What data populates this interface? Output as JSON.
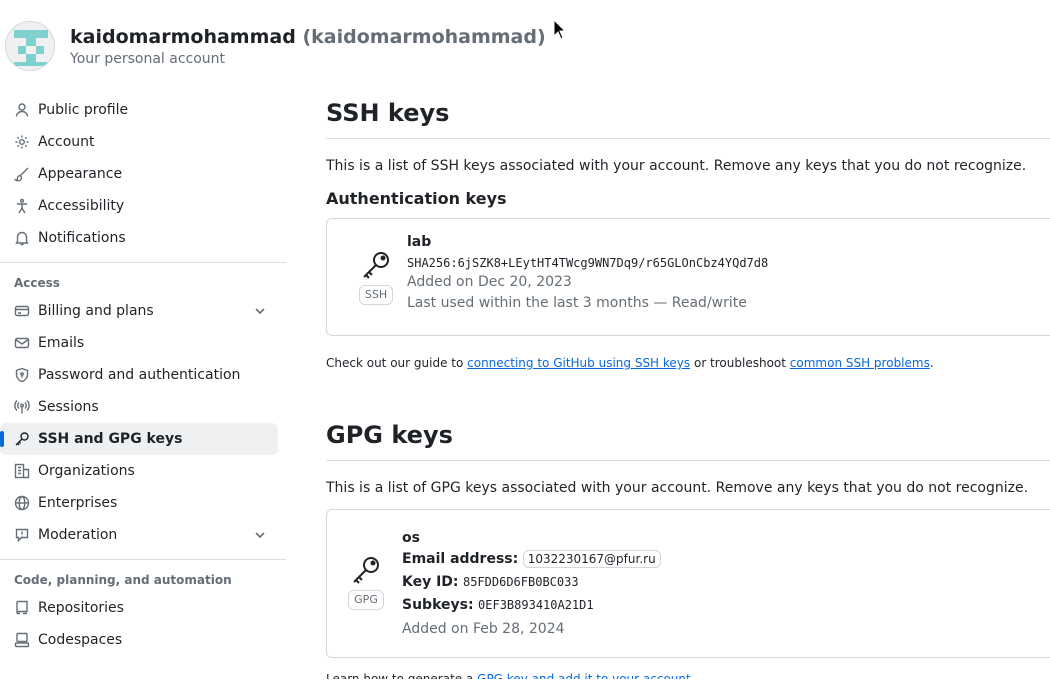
{
  "user": {
    "name": "kaidomarmohammad",
    "login": "(kaidomarmohammad)",
    "subtitle": "Your personal account"
  },
  "sidebar": {
    "items": [
      {
        "label": "Public profile",
        "icon": "person-icon"
      },
      {
        "label": "Account",
        "icon": "gear-icon"
      },
      {
        "label": "Appearance",
        "icon": "paintbrush-icon"
      },
      {
        "label": "Accessibility",
        "icon": "accessibility-icon"
      },
      {
        "label": "Notifications",
        "icon": "bell-icon"
      }
    ],
    "access_title": "Access",
    "access_items": [
      {
        "label": "Billing and plans",
        "icon": "credit-card-icon"
      },
      {
        "label": "Emails",
        "icon": "mail-icon"
      },
      {
        "label": "Password and authentication",
        "icon": "shield-lock-icon"
      },
      {
        "label": "Sessions",
        "icon": "broadcast-icon"
      },
      {
        "label": "SSH and GPG keys",
        "icon": "key-icon"
      },
      {
        "label": "Organizations",
        "icon": "organization-icon"
      },
      {
        "label": "Enterprises",
        "icon": "globe-icon"
      },
      {
        "label": "Moderation",
        "icon": "report-icon"
      }
    ],
    "code_title": "Code, planning, and automation",
    "code_items": [
      {
        "label": "Repositories",
        "icon": "repo-icon"
      },
      {
        "label": "Codespaces",
        "icon": "codespaces-icon"
      }
    ]
  },
  "ssh": {
    "title": "SSH keys",
    "description": "This is a list of SSH keys associated with your account. Remove any keys that you do not recognize.",
    "auth_title": "Authentication keys",
    "key": {
      "type_label": "SSH",
      "title": "lab",
      "fingerprint": "SHA256:6jSZK8+LEytHT4TWcg9WN7Dq9/r65GLOnCbz4YQd7d8",
      "added": "Added on Dec 20, 2023",
      "last_used": "Last used within the last 3 months — Read/write"
    },
    "help_prefix": "Check out our guide to ",
    "help_link1": "connecting to GitHub using SSH keys",
    "help_middle": " or troubleshoot ",
    "help_link2": "common SSH problems",
    "help_suffix": "."
  },
  "gpg": {
    "title": "GPG keys",
    "description": "This is a list of GPG keys associated with your account. Remove any keys that you do not recognize.",
    "key": {
      "type_label": "GPG",
      "title": "os",
      "email_label": "Email address:",
      "email": "1032230167@pfur.ru",
      "keyid_label": "Key ID:",
      "keyid": "85FDD6D6FB0BC033",
      "subkeys_label": "Subkeys:",
      "subkeys": "0EF3B893410A21D1",
      "added": "Added on Feb 28, 2024"
    },
    "help_prefix": "Learn how to generate a ",
    "help_link": "GPG key and add it to your account"
  },
  "colors": {
    "accent": "#0969da",
    "muted": "#656d76",
    "border": "#d0d7de"
  }
}
